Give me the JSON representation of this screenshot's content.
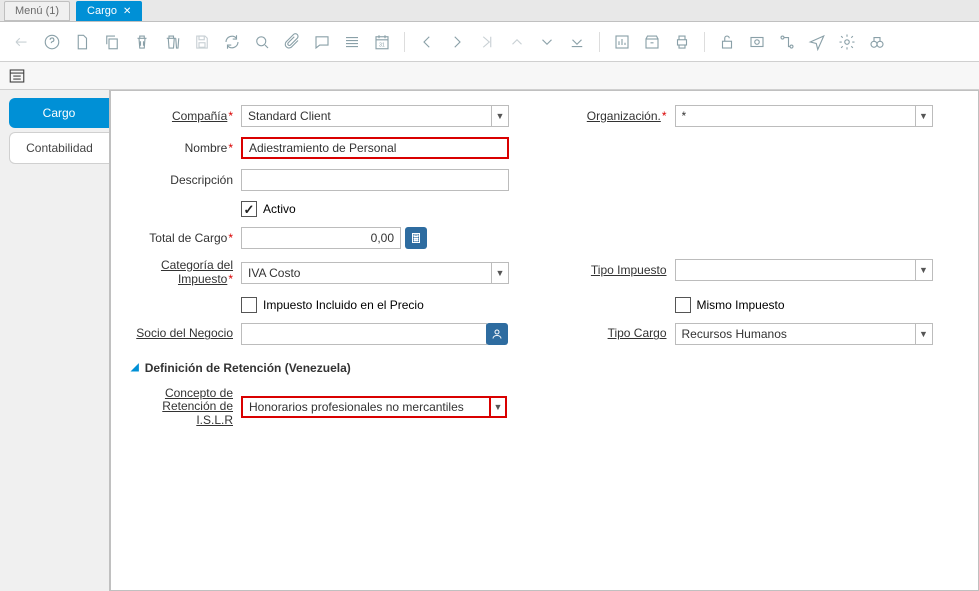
{
  "tabs": {
    "menu_lbl": "Menú (1)",
    "cargo_lbl": "Cargo"
  },
  "sidebar": {
    "cargo": "Cargo",
    "contabilidad": "Contabilidad"
  },
  "labels": {
    "compania": "Compañía",
    "organizacion": "Organización.",
    "nombre": "Nombre",
    "descripcion": "Descripción",
    "activo": "Activo",
    "total_cargo": "Total de Cargo",
    "categoria_impuesto": "Categoría del Impuesto",
    "tipo_impuesto": "Tipo Impuesto",
    "impuesto_incluido": "Impuesto Incluido en el Precio",
    "mismo_impuesto": "Mismo Impuesto",
    "socio_negocio": "Socio del Negocio",
    "tipo_cargo": "Tipo Cargo",
    "section_retencion": "Definición de Retención (Venezuela)",
    "concepto_retencion": "Concepto de Retención de I.S.L.R"
  },
  "values": {
    "compania": "Standard Client",
    "organizacion": "*",
    "nombre": "Adiestramiento de Personal",
    "descripcion": "",
    "activo_checked": true,
    "total_cargo": "0,00",
    "categoria_impuesto": "IVA Costo",
    "tipo_impuesto": "",
    "impuesto_incluido_checked": false,
    "mismo_impuesto_checked": false,
    "socio_negocio": "",
    "tipo_cargo": "Recursos Humanos",
    "concepto_retencion": "Honorarios profesionales no mercantiles"
  }
}
